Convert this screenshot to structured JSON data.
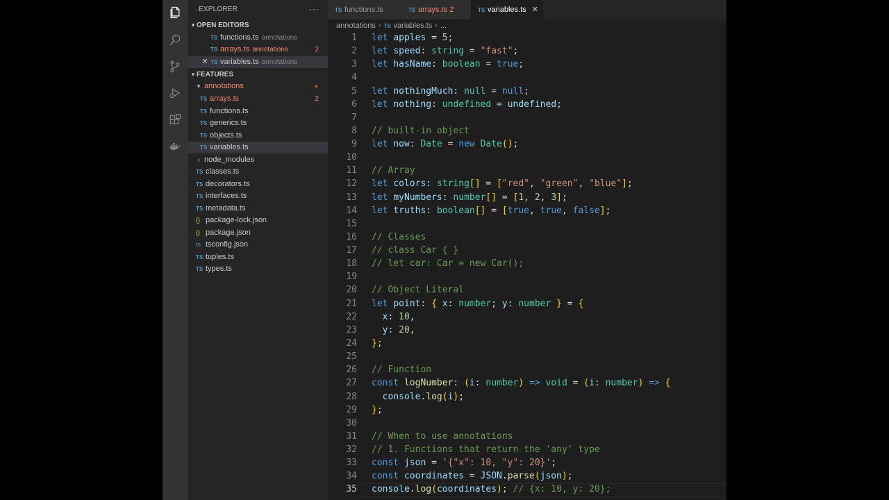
{
  "explorer": {
    "title": "EXPLORER",
    "more": "···",
    "open_editors": {
      "label": "OPEN EDITORS",
      "items": [
        {
          "name": "functions.ts",
          "desc": "annotations",
          "badge": ""
        },
        {
          "name": "arrays.ts",
          "desc": "annotations",
          "badge": "2"
        },
        {
          "name": "variables.ts",
          "desc": "annotations",
          "badge": "",
          "close": "✕"
        }
      ]
    },
    "features": {
      "label": "FEATURES",
      "annotations_folder": "annotations",
      "annotations_files": [
        {
          "name": "arrays.ts",
          "badge": "2"
        },
        {
          "name": "functions.ts"
        },
        {
          "name": "generics.ts"
        },
        {
          "name": "objects.ts"
        },
        {
          "name": "variables.ts"
        }
      ],
      "node_modules": "node_modules",
      "files": [
        {
          "name": "classes.ts",
          "kind": "TS"
        },
        {
          "name": "decorators.ts",
          "kind": "TS"
        },
        {
          "name": "interfaces.ts",
          "kind": "TS"
        },
        {
          "name": "metadata.ts",
          "kind": "TS"
        },
        {
          "name": "package-lock.json",
          "kind": "{}"
        },
        {
          "name": "package.json",
          "kind": "{}"
        },
        {
          "name": "tsconfig.json",
          "kind": "ts"
        },
        {
          "name": "tuples.ts",
          "kind": "TS"
        },
        {
          "name": "types.ts",
          "kind": "TS"
        }
      ]
    }
  },
  "tabs": [
    {
      "label": "functions.ts",
      "badge": ""
    },
    {
      "label": "arrays.ts",
      "badge": "2"
    },
    {
      "label": "variables.ts",
      "badge": "",
      "close": "✕"
    }
  ],
  "ts_icon": "TS",
  "breadcrumb": {
    "folder": "annotations",
    "file": "variables.ts",
    "more": "...",
    "sep": "›"
  },
  "current_line": 35,
  "colors": {
    "keyword": "#569cd6",
    "variable": "#9cdcfe",
    "type": "#4ec9b0",
    "string": "#ce9178",
    "number": "#b5cea8",
    "comment": "#6a9955",
    "function": "#dcdcaa",
    "bracket": "#ffd700",
    "default": "#d4d4d4"
  },
  "code_lines": [
    [
      [
        "let ",
        "k"
      ],
      [
        "apples",
        "v"
      ],
      [
        " = ",
        "d"
      ],
      [
        "5",
        "n"
      ],
      [
        ";",
        "d"
      ]
    ],
    [
      [
        "let ",
        "k"
      ],
      [
        "speed",
        "v"
      ],
      [
        ": ",
        "d"
      ],
      [
        "string",
        "t"
      ],
      [
        " = ",
        "d"
      ],
      [
        "\"fast\"",
        "s"
      ],
      [
        ";",
        "d"
      ]
    ],
    [
      [
        "let ",
        "k"
      ],
      [
        "hasName",
        "v"
      ],
      [
        ": ",
        "d"
      ],
      [
        "boolean",
        "t"
      ],
      [
        " = ",
        "d"
      ],
      [
        "true",
        "k"
      ],
      [
        ";",
        "d"
      ]
    ],
    [],
    [
      [
        "let ",
        "k"
      ],
      [
        "nothingMuch",
        "v"
      ],
      [
        ": ",
        "d"
      ],
      [
        "null",
        "t"
      ],
      [
        " = ",
        "d"
      ],
      [
        "null",
        "k"
      ],
      [
        ";",
        "d"
      ]
    ],
    [
      [
        "let ",
        "k"
      ],
      [
        "nothing",
        "v"
      ],
      [
        ": ",
        "d"
      ],
      [
        "undefined",
        "t"
      ],
      [
        " = ",
        "d"
      ],
      [
        "undefined",
        "v"
      ],
      [
        ";",
        "d"
      ]
    ],
    [],
    [
      [
        "// built-in object",
        "c"
      ]
    ],
    [
      [
        "let ",
        "k"
      ],
      [
        "now",
        "v"
      ],
      [
        ": ",
        "d"
      ],
      [
        "Date",
        "t"
      ],
      [
        " = ",
        "d"
      ],
      [
        "new ",
        "k"
      ],
      [
        "Date",
        "t"
      ],
      [
        "()",
        "b"
      ],
      [
        ";",
        "d"
      ]
    ],
    [],
    [
      [
        "// Array",
        "c"
      ]
    ],
    [
      [
        "let ",
        "k"
      ],
      [
        "colors",
        "v"
      ],
      [
        ": ",
        "d"
      ],
      [
        "string",
        "t"
      ],
      [
        "[]",
        "b"
      ],
      [
        " = ",
        "d"
      ],
      [
        "[",
        "b"
      ],
      [
        "\"red\"",
        "s"
      ],
      [
        ", ",
        "d"
      ],
      [
        "\"green\"",
        "s"
      ],
      [
        ", ",
        "d"
      ],
      [
        "\"blue\"",
        "s"
      ],
      [
        "]",
        "b"
      ],
      [
        ";",
        "d"
      ]
    ],
    [
      [
        "let ",
        "k"
      ],
      [
        "myNumbers",
        "v"
      ],
      [
        ": ",
        "d"
      ],
      [
        "number",
        "t"
      ],
      [
        "[]",
        "b"
      ],
      [
        " = ",
        "d"
      ],
      [
        "[",
        "b"
      ],
      [
        "1",
        "n"
      ],
      [
        ", ",
        "d"
      ],
      [
        "2",
        "n"
      ],
      [
        ", ",
        "d"
      ],
      [
        "3",
        "n"
      ],
      [
        "]",
        "b"
      ],
      [
        ";",
        "d"
      ]
    ],
    [
      [
        "let ",
        "k"
      ],
      [
        "truths",
        "v"
      ],
      [
        ": ",
        "d"
      ],
      [
        "boolean",
        "t"
      ],
      [
        "[]",
        "b"
      ],
      [
        " = ",
        "d"
      ],
      [
        "[",
        "b"
      ],
      [
        "true",
        "k"
      ],
      [
        ", ",
        "d"
      ],
      [
        "true",
        "k"
      ],
      [
        ", ",
        "d"
      ],
      [
        "false",
        "k"
      ],
      [
        "]",
        "b"
      ],
      [
        ";",
        "d"
      ]
    ],
    [],
    [
      [
        "// Classes",
        "c"
      ]
    ],
    [
      [
        "// class Car { }",
        "c"
      ]
    ],
    [
      [
        "// let car: Car = new Car();",
        "c"
      ]
    ],
    [],
    [
      [
        "// Object Literal",
        "c"
      ]
    ],
    [
      [
        "let ",
        "k"
      ],
      [
        "point",
        "v"
      ],
      [
        ": ",
        "d"
      ],
      [
        "{",
        "b"
      ],
      [
        " ",
        "d"
      ],
      [
        "x",
        "v"
      ],
      [
        ": ",
        "d"
      ],
      [
        "number",
        "t"
      ],
      [
        "; ",
        "d"
      ],
      [
        "y",
        "v"
      ],
      [
        ": ",
        "d"
      ],
      [
        "number",
        "t"
      ],
      [
        " ",
        "d"
      ],
      [
        "}",
        "b"
      ],
      [
        " = ",
        "d"
      ],
      [
        "{",
        "b"
      ]
    ],
    [
      [
        "  ",
        "d"
      ],
      [
        "x",
        "v"
      ],
      [
        ": ",
        "d"
      ],
      [
        "10",
        "n"
      ],
      [
        ",",
        "d"
      ]
    ],
    [
      [
        "  ",
        "d"
      ],
      [
        "y",
        "v"
      ],
      [
        ": ",
        "d"
      ],
      [
        "20",
        "n"
      ],
      [
        ",",
        "d"
      ]
    ],
    [
      [
        "}",
        "b"
      ],
      [
        ";",
        "d"
      ]
    ],
    [],
    [
      [
        "// Function",
        "c"
      ]
    ],
    [
      [
        "const ",
        "k"
      ],
      [
        "logNumber",
        "f"
      ],
      [
        ": ",
        "d"
      ],
      [
        "(",
        "b"
      ],
      [
        "i",
        "v"
      ],
      [
        ": ",
        "d"
      ],
      [
        "number",
        "t"
      ],
      [
        ")",
        "b"
      ],
      [
        " => ",
        "k"
      ],
      [
        "void",
        "t"
      ],
      [
        " = ",
        "d"
      ],
      [
        "(",
        "b"
      ],
      [
        "i",
        "v"
      ],
      [
        ": ",
        "d"
      ],
      [
        "number",
        "t"
      ],
      [
        ")",
        "b"
      ],
      [
        " => ",
        "k"
      ],
      [
        "{",
        "b"
      ]
    ],
    [
      [
        "  ",
        "d"
      ],
      [
        "console",
        "v"
      ],
      [
        ".",
        "d"
      ],
      [
        "log",
        "f"
      ],
      [
        "(",
        "b"
      ],
      [
        "i",
        "v"
      ],
      [
        ")",
        "b"
      ],
      [
        ";",
        "d"
      ]
    ],
    [
      [
        "}",
        "b"
      ],
      [
        ";",
        "d"
      ]
    ],
    [],
    [
      [
        "// When to use annotations",
        "c"
      ]
    ],
    [
      [
        "// 1. Functions that return the 'any' type",
        "c"
      ]
    ],
    [
      [
        "const ",
        "k"
      ],
      [
        "json",
        "v"
      ],
      [
        " = ",
        "d"
      ],
      [
        "'{\"x\": 10, \"y\": 20}'",
        "s"
      ],
      [
        ";",
        "d"
      ]
    ],
    [
      [
        "const ",
        "k"
      ],
      [
        "coordinates",
        "v"
      ],
      [
        " = ",
        "d"
      ],
      [
        "JSON",
        "v"
      ],
      [
        ".",
        "d"
      ],
      [
        "parse",
        "f"
      ],
      [
        "(",
        "b"
      ],
      [
        "json",
        "v"
      ],
      [
        ")",
        "b"
      ],
      [
        ";",
        "d"
      ]
    ],
    [
      [
        "console",
        "v"
      ],
      [
        ".",
        "d"
      ],
      [
        "log",
        "f"
      ],
      [
        "(",
        "b"
      ],
      [
        "coordinates",
        "v"
      ],
      [
        ")",
        "b"
      ],
      [
        ";",
        "d"
      ],
      [
        " // {x: 10, y: 20};",
        "c"
      ]
    ]
  ]
}
